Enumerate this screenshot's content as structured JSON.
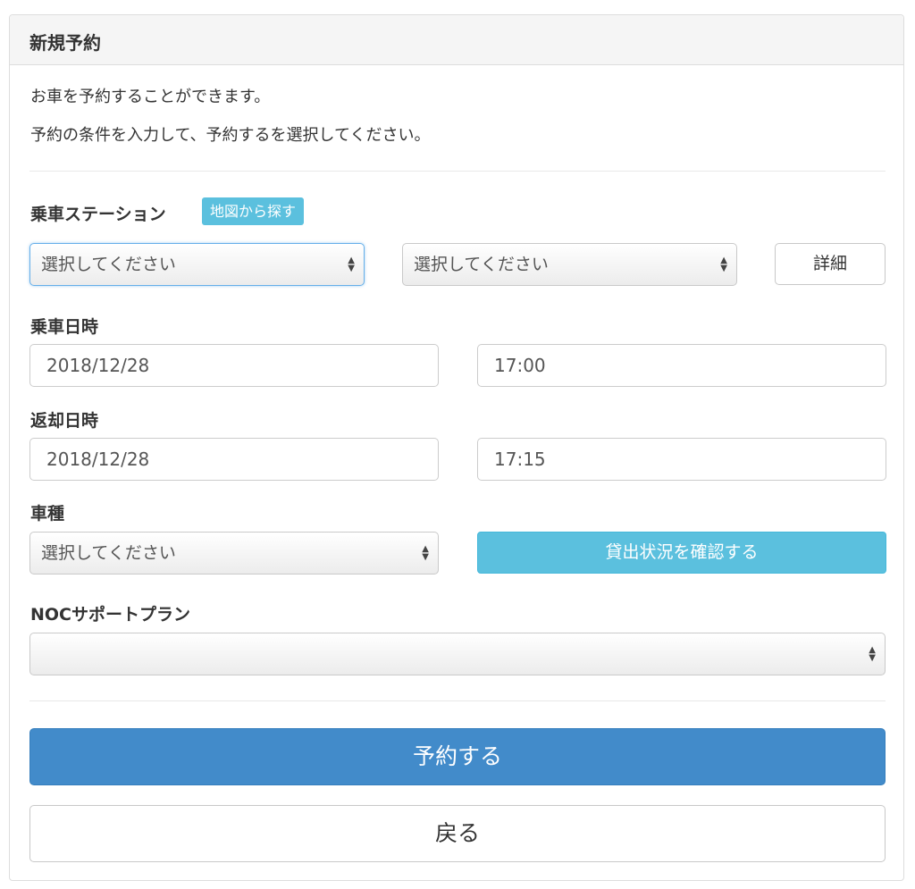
{
  "panel": {
    "title": "新規予約"
  },
  "intro": {
    "line1": "お車を予約することができます。",
    "line2": "予約の条件を入力して、予約するを選択してください。"
  },
  "station": {
    "label": "乗車ステーション",
    "map_badge": "地図から探す",
    "select1_value": "選択してください",
    "select2_value": "選択してください",
    "details_button": "詳細"
  },
  "pickup": {
    "label": "乗車日時",
    "date": "2018/12/28",
    "time": "17:00"
  },
  "return": {
    "label": "返却日時",
    "date": "2018/12/28",
    "time": "17:15"
  },
  "car_type": {
    "label": "車種",
    "select_value": "選択してください",
    "availability_button": "貸出状況を確認する"
  },
  "noc": {
    "label": "NOCサポートプラン",
    "select_value": ""
  },
  "actions": {
    "reserve": "予約する",
    "back": "戻る"
  },
  "icons": {
    "select_arrows": "updown-arrows-icon"
  },
  "colors": {
    "primary": "#428bca",
    "info": "#5bc0de",
    "focus": "#66afe9"
  }
}
